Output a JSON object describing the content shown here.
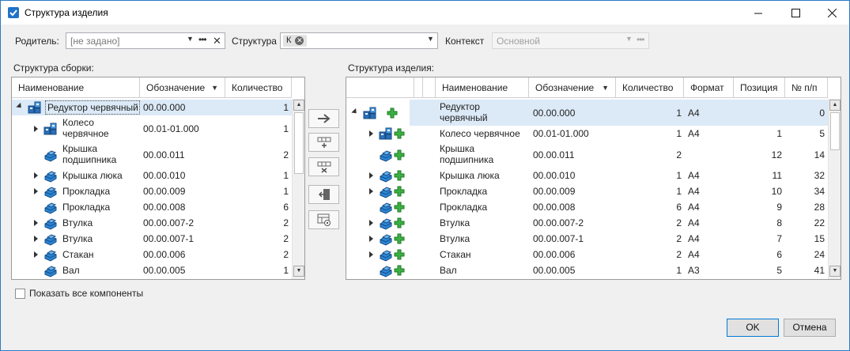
{
  "window": {
    "title": "Структура изделия"
  },
  "filters": {
    "parent_label": "Родитель:",
    "parent_placeholder": "[не задано]",
    "structure_label": "Структура",
    "structure_chip": "К",
    "context_label": "Контекст",
    "context_value": "Основной"
  },
  "left": {
    "title": "Структура сборки:",
    "columns": [
      "Наименование",
      "Обозначение",
      "Количество"
    ],
    "rows": [
      {
        "name": "Редуктор червячный",
        "code": "00.00.000",
        "qty": "1",
        "icon": "assembly-icon",
        "expand": "down",
        "selected": true
      },
      {
        "name": "Колесо червячное",
        "code": "00.01-01.000",
        "qty": "1",
        "icon": "assembly-icon",
        "expand": "right"
      },
      {
        "name": "Крышка подшипника",
        "code": "00.00.011",
        "qty": "2",
        "icon": "part-icon",
        "expand": ""
      },
      {
        "name": "Крышка люка",
        "code": "00.00.010",
        "qty": "1",
        "icon": "part-icon",
        "expand": "right"
      },
      {
        "name": "Прокладка",
        "code": "00.00.009",
        "qty": "1",
        "icon": "part-icon",
        "expand": "right"
      },
      {
        "name": "Прокладка",
        "code": "00.00.008",
        "qty": "6",
        "icon": "part-icon",
        "expand": ""
      },
      {
        "name": "Втулка",
        "code": "00.00.007-2",
        "qty": "2",
        "icon": "part-icon",
        "expand": "right"
      },
      {
        "name": "Втулка",
        "code": "00.00.007-1",
        "qty": "2",
        "icon": "part-icon",
        "expand": "right"
      },
      {
        "name": "Стакан",
        "code": "00.00.006",
        "qty": "2",
        "icon": "part-icon",
        "expand": "right"
      },
      {
        "name": "Вал",
        "code": "00.00.005",
        "qty": "1",
        "icon": "part-icon",
        "expand": ""
      }
    ]
  },
  "right": {
    "title": "Структура изделия:",
    "columns": [
      "Наименование",
      "Обозначение",
      "Количество",
      "Формат",
      "Позиция",
      "№ п/п"
    ],
    "rows": [
      {
        "name": "Редуктор червячный",
        "code": "00.00.000",
        "qty": "1",
        "format": "A4",
        "pos": "",
        "num": "0",
        "icon": "assembly-icon",
        "expand": "down",
        "selected": true
      },
      {
        "name": "Колесо червячное",
        "code": "00.01-01.000",
        "qty": "1",
        "format": "A4",
        "pos": "1",
        "num": "5",
        "icon": "assembly-icon",
        "expand": "right"
      },
      {
        "name": "Крышка подшипника",
        "code": "00.00.011",
        "qty": "2",
        "format": "",
        "pos": "12",
        "num": "14",
        "icon": "part-icon",
        "expand": ""
      },
      {
        "name": "Крышка люка",
        "code": "00.00.010",
        "qty": "1",
        "format": "A4",
        "pos": "11",
        "num": "32",
        "icon": "part-icon",
        "expand": "right"
      },
      {
        "name": "Прокладка",
        "code": "00.00.009",
        "qty": "1",
        "format": "A4",
        "pos": "10",
        "num": "34",
        "icon": "part-icon",
        "expand": "right"
      },
      {
        "name": "Прокладка",
        "code": "00.00.008",
        "qty": "6",
        "format": "A4",
        "pos": "9",
        "num": "28",
        "icon": "part-icon",
        "expand": ""
      },
      {
        "name": "Втулка",
        "code": "00.00.007-2",
        "qty": "2",
        "format": "A4",
        "pos": "8",
        "num": "22",
        "icon": "part-icon",
        "expand": "right"
      },
      {
        "name": "Втулка",
        "code": "00.00.007-1",
        "qty": "2",
        "format": "A4",
        "pos": "7",
        "num": "15",
        "icon": "part-icon",
        "expand": "right"
      },
      {
        "name": "Стакан",
        "code": "00.00.006",
        "qty": "2",
        "format": "A4",
        "pos": "6",
        "num": "24",
        "icon": "part-icon",
        "expand": "right"
      },
      {
        "name": "Вал",
        "code": "00.00.005",
        "qty": "1",
        "format": "A3",
        "pos": "5",
        "num": "41",
        "icon": "part-icon",
        "expand": ""
      }
    ]
  },
  "show_all_label": "Показать все компоненты",
  "ok_label": "OK",
  "cancel_label": "Отмена",
  "colors": {
    "accent": "#0078d7",
    "selection": "#dceaf7",
    "part": "#2a86d6",
    "plus": "#3cb043"
  }
}
